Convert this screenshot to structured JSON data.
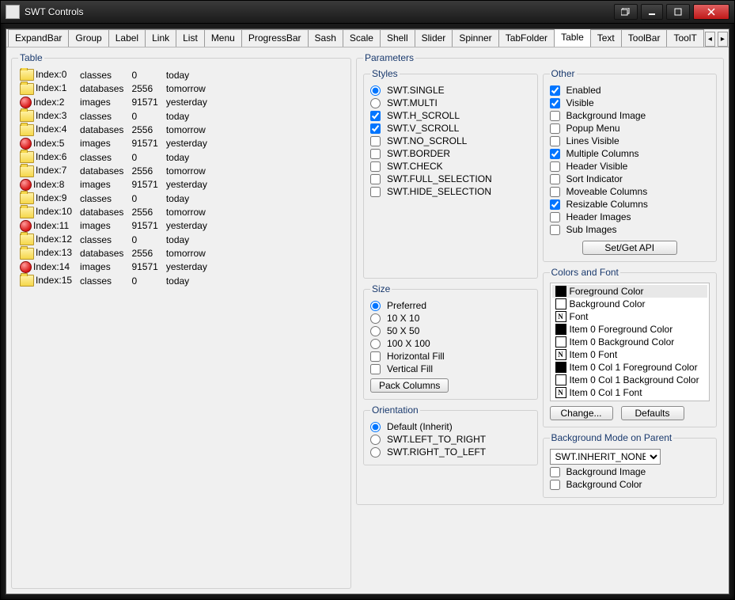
{
  "window": {
    "title": "SWT Controls"
  },
  "tabs": {
    "items": [
      "ExpandBar",
      "Group",
      "Label",
      "Link",
      "List",
      "Menu",
      "ProgressBar",
      "Sash",
      "Scale",
      "Shell",
      "Slider",
      "Spinner",
      "TabFolder",
      "Table",
      "Text",
      "ToolBar",
      "ToolT"
    ],
    "active": "Table"
  },
  "tableGroup": {
    "legend": "Table"
  },
  "tableRows": [
    {
      "icon": "folder",
      "c0": "Index:0",
      "c1": "classes",
      "c2": "0",
      "c3": "today"
    },
    {
      "icon": "folder",
      "c0": "Index:1",
      "c1": "databases",
      "c2": "2556",
      "c3": "tomorrow"
    },
    {
      "icon": "red",
      "c0": "Index:2",
      "c1": "images",
      "c2": "91571",
      "c3": "yesterday"
    },
    {
      "icon": "folder",
      "c0": "Index:3",
      "c1": "classes",
      "c2": "0",
      "c3": "today"
    },
    {
      "icon": "folder",
      "c0": "Index:4",
      "c1": "databases",
      "c2": "2556",
      "c3": "tomorrow"
    },
    {
      "icon": "red",
      "c0": "Index:5",
      "c1": "images",
      "c2": "91571",
      "c3": "yesterday"
    },
    {
      "icon": "folder",
      "c0": "Index:6",
      "c1": "classes",
      "c2": "0",
      "c3": "today"
    },
    {
      "icon": "folder",
      "c0": "Index:7",
      "c1": "databases",
      "c2": "2556",
      "c3": "tomorrow"
    },
    {
      "icon": "red",
      "c0": "Index:8",
      "c1": "images",
      "c2": "91571",
      "c3": "yesterday"
    },
    {
      "icon": "folder",
      "c0": "Index:9",
      "c1": "classes",
      "c2": "0",
      "c3": "today"
    },
    {
      "icon": "folder",
      "c0": "Index:10",
      "c1": "databases",
      "c2": "2556",
      "c3": "tomorrow"
    },
    {
      "icon": "red",
      "c0": "Index:11",
      "c1": "images",
      "c2": "91571",
      "c3": "yesterday"
    },
    {
      "icon": "folder",
      "c0": "Index:12",
      "c1": "classes",
      "c2": "0",
      "c3": "today"
    },
    {
      "icon": "folder",
      "c0": "Index:13",
      "c1": "databases",
      "c2": "2556",
      "c3": "tomorrow"
    },
    {
      "icon": "red",
      "c0": "Index:14",
      "c1": "images",
      "c2": "91571",
      "c3": "yesterday"
    },
    {
      "icon": "folder",
      "c0": "Index:15",
      "c1": "classes",
      "c2": "0",
      "c3": "today"
    }
  ],
  "parameters": {
    "legend": "Parameters"
  },
  "styles": {
    "legend": "Styles",
    "items": [
      {
        "type": "radio",
        "label": "SWT.SINGLE",
        "checked": true
      },
      {
        "type": "radio",
        "label": "SWT.MULTI",
        "checked": false
      },
      {
        "type": "check",
        "label": "SWT.H_SCROLL",
        "checked": true
      },
      {
        "type": "check",
        "label": "SWT.V_SCROLL",
        "checked": true
      },
      {
        "type": "check",
        "label": "SWT.NO_SCROLL",
        "checked": false
      },
      {
        "type": "check",
        "label": "SWT.BORDER",
        "checked": false
      },
      {
        "type": "check",
        "label": "SWT.CHECK",
        "checked": false
      },
      {
        "type": "check",
        "label": "SWT.FULL_SELECTION",
        "checked": false
      },
      {
        "type": "check",
        "label": "SWT.HIDE_SELECTION",
        "checked": false
      }
    ]
  },
  "other": {
    "legend": "Other",
    "items": [
      {
        "label": "Enabled",
        "checked": true
      },
      {
        "label": "Visible",
        "checked": true
      },
      {
        "label": "Background Image",
        "checked": false
      },
      {
        "label": "Popup Menu",
        "checked": false
      },
      {
        "label": "Lines Visible",
        "checked": false
      },
      {
        "label": "Multiple Columns",
        "checked": true
      },
      {
        "label": "Header Visible",
        "checked": false
      },
      {
        "label": "Sort Indicator",
        "checked": false
      },
      {
        "label": "Moveable Columns",
        "checked": false
      },
      {
        "label": "Resizable Columns",
        "checked": true
      },
      {
        "label": "Header Images",
        "checked": false
      },
      {
        "label": "Sub Images",
        "checked": false
      }
    ],
    "button": "Set/Get API"
  },
  "size": {
    "legend": "Size",
    "radios": [
      {
        "label": "Preferred",
        "checked": true
      },
      {
        "label": "10 X 10",
        "checked": false
      },
      {
        "label": "50 X 50",
        "checked": false
      },
      {
        "label": "100 X 100",
        "checked": false
      }
    ],
    "checks": [
      {
        "label": "Horizontal Fill",
        "checked": false
      },
      {
        "label": "Vertical Fill",
        "checked": false
      }
    ],
    "button": "Pack Columns"
  },
  "colors": {
    "legend": "Colors and Font",
    "items": [
      {
        "sw": "black",
        "label": "Foreground Color",
        "selected": true
      },
      {
        "sw": "white",
        "label": "Background Color"
      },
      {
        "sw": "font",
        "label": "Font"
      },
      {
        "sw": "black",
        "label": "Item 0 Foreground Color"
      },
      {
        "sw": "white",
        "label": "Item 0 Background Color"
      },
      {
        "sw": "font",
        "label": "Item 0 Font"
      },
      {
        "sw": "black",
        "label": "Item 0 Col 1 Foreground Color"
      },
      {
        "sw": "white",
        "label": "Item 0 Col 1 Background Color"
      },
      {
        "sw": "font",
        "label": "Item 0 Col 1 Font"
      }
    ],
    "changeBtn": "Change...",
    "defaultsBtn": "Defaults"
  },
  "orientation": {
    "legend": "Orientation",
    "items": [
      {
        "label": "Default (Inherit)",
        "checked": true
      },
      {
        "label": "SWT.LEFT_TO_RIGHT",
        "checked": false
      },
      {
        "label": "SWT.RIGHT_TO_LEFT",
        "checked": false
      }
    ]
  },
  "bgmode": {
    "legend": "Background Mode on Parent",
    "combo": "SWT.INHERIT_NONE",
    "checks": [
      {
        "label": "Background Image",
        "checked": false
      },
      {
        "label": "Background Color",
        "checked": false
      }
    ]
  }
}
